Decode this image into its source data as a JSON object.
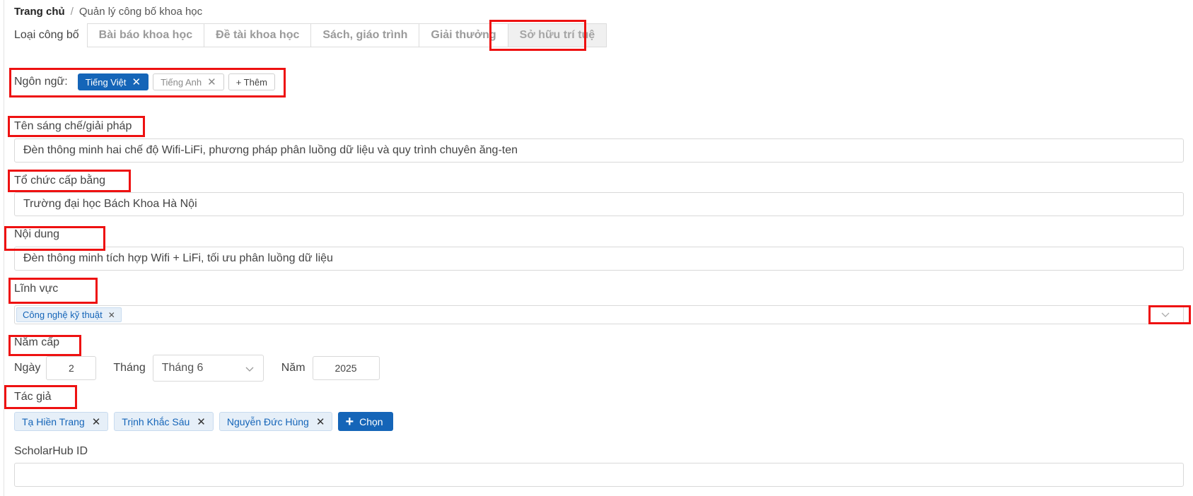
{
  "breadcrumb": {
    "home": "Trang chủ",
    "separator": "/",
    "current": "Quản lý công bố khoa học"
  },
  "publication_type": {
    "label": "Loại công bố",
    "tabs": [
      "Bài báo khoa học",
      "Đề tài khoa học",
      "Sách, giáo trình",
      "Giải thưởng",
      "Sở hữu trí tuệ"
    ],
    "active_index": 4
  },
  "language": {
    "label": "Ngôn ngữ:",
    "selected": "Tiếng Việt",
    "other": "Tiếng Anh",
    "add_label": "+ Thêm"
  },
  "fields": {
    "invention_name": {
      "label": "Tên sáng chế/giải pháp",
      "value": "Đèn thông minh hai chế độ Wifi-LiFi, phương pháp phân luồng dữ liệu và quy trình chuyên ăng-ten"
    },
    "issuing_org": {
      "label": "Tổ chức cấp bằng",
      "value": "Trường đại học Bách Khoa Hà Nội"
    },
    "content": {
      "label": "Nội dung",
      "value": "Đèn thông minh tích hợp Wifi + LiFi, tối ưu phân luồng dữ liệu"
    },
    "field_area": {
      "label": "Lĩnh vực",
      "tag": "Công nghệ kỹ thuật"
    },
    "issue_year": {
      "label": "Năm cấp",
      "day_label": "Ngày",
      "day_value": "2",
      "month_label": "Tháng",
      "month_value": "Tháng 6",
      "year_label": "Năm",
      "year_value": "2025"
    },
    "authors": {
      "label": "Tác giả",
      "list": [
        "Tạ Hiền Trang",
        "Trịnh Khắc Sáu",
        "Nguyễn Đức Hùng"
      ],
      "choose_label": "Chọn"
    },
    "scholarhub": {
      "label": "ScholarHub ID",
      "value": ""
    }
  },
  "colors": {
    "primary": "#1565b8",
    "highlight": "#ee1111",
    "tag_bg": "#e6eff8"
  }
}
